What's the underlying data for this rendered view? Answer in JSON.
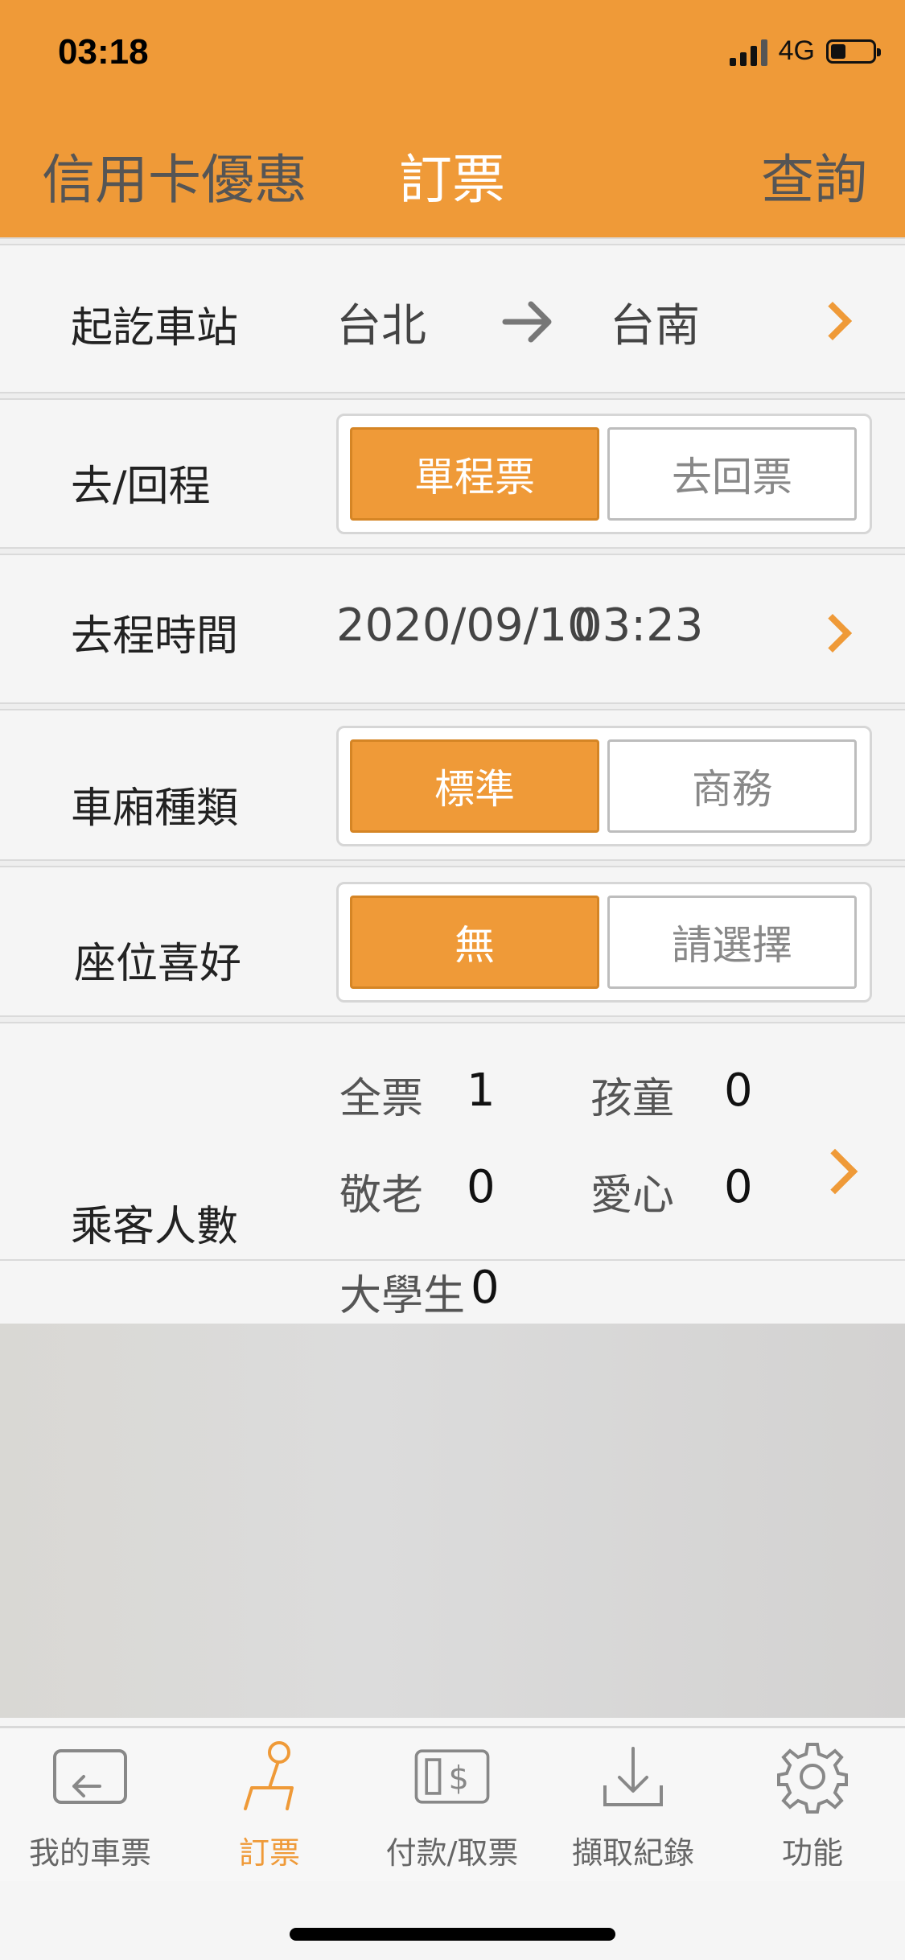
{
  "status_bar": {
    "time": "03:18",
    "network": "4G"
  },
  "top_tabs": [
    {
      "label": "信用卡優惠",
      "active": false
    },
    {
      "label": "訂票",
      "active": true
    },
    {
      "label": "查詢",
      "active": false
    }
  ],
  "stations": {
    "label": "起訖車站",
    "from": "台北",
    "to": "台南"
  },
  "trip_type": {
    "label": "去/回程",
    "options": [
      "單程票",
      "去回票"
    ],
    "selected": "單程票"
  },
  "departure": {
    "label": "去程時間",
    "date": "2020/09/10",
    "time": "03:23"
  },
  "car_type": {
    "label": "車廂種類",
    "options": [
      "標準",
      "商務"
    ],
    "selected": "標準"
  },
  "seat_pref": {
    "label": "座位喜好",
    "options": [
      "無",
      "請選擇"
    ],
    "selected": "無"
  },
  "passengers": {
    "label": "乘客人數",
    "items": [
      {
        "type": "全票",
        "count": "1"
      },
      {
        "type": "孩童",
        "count": "0"
      },
      {
        "type": "敬老",
        "count": "0"
      },
      {
        "type": "愛心",
        "count": "0"
      },
      {
        "type": "大學生",
        "count": "0"
      }
    ]
  },
  "bottom_nav": [
    {
      "label": "我的車票",
      "icon": "ticket-back-icon",
      "active": false
    },
    {
      "label": "訂票",
      "icon": "seat-icon",
      "active": true
    },
    {
      "label": "付款/取票",
      "icon": "payment-icon",
      "active": false
    },
    {
      "label": "擷取紀錄",
      "icon": "download-icon",
      "active": false
    },
    {
      "label": "功能",
      "icon": "gear-icon",
      "active": false
    }
  ],
  "colors": {
    "accent": "#ef9a38",
    "background": "#f5f5f5"
  }
}
